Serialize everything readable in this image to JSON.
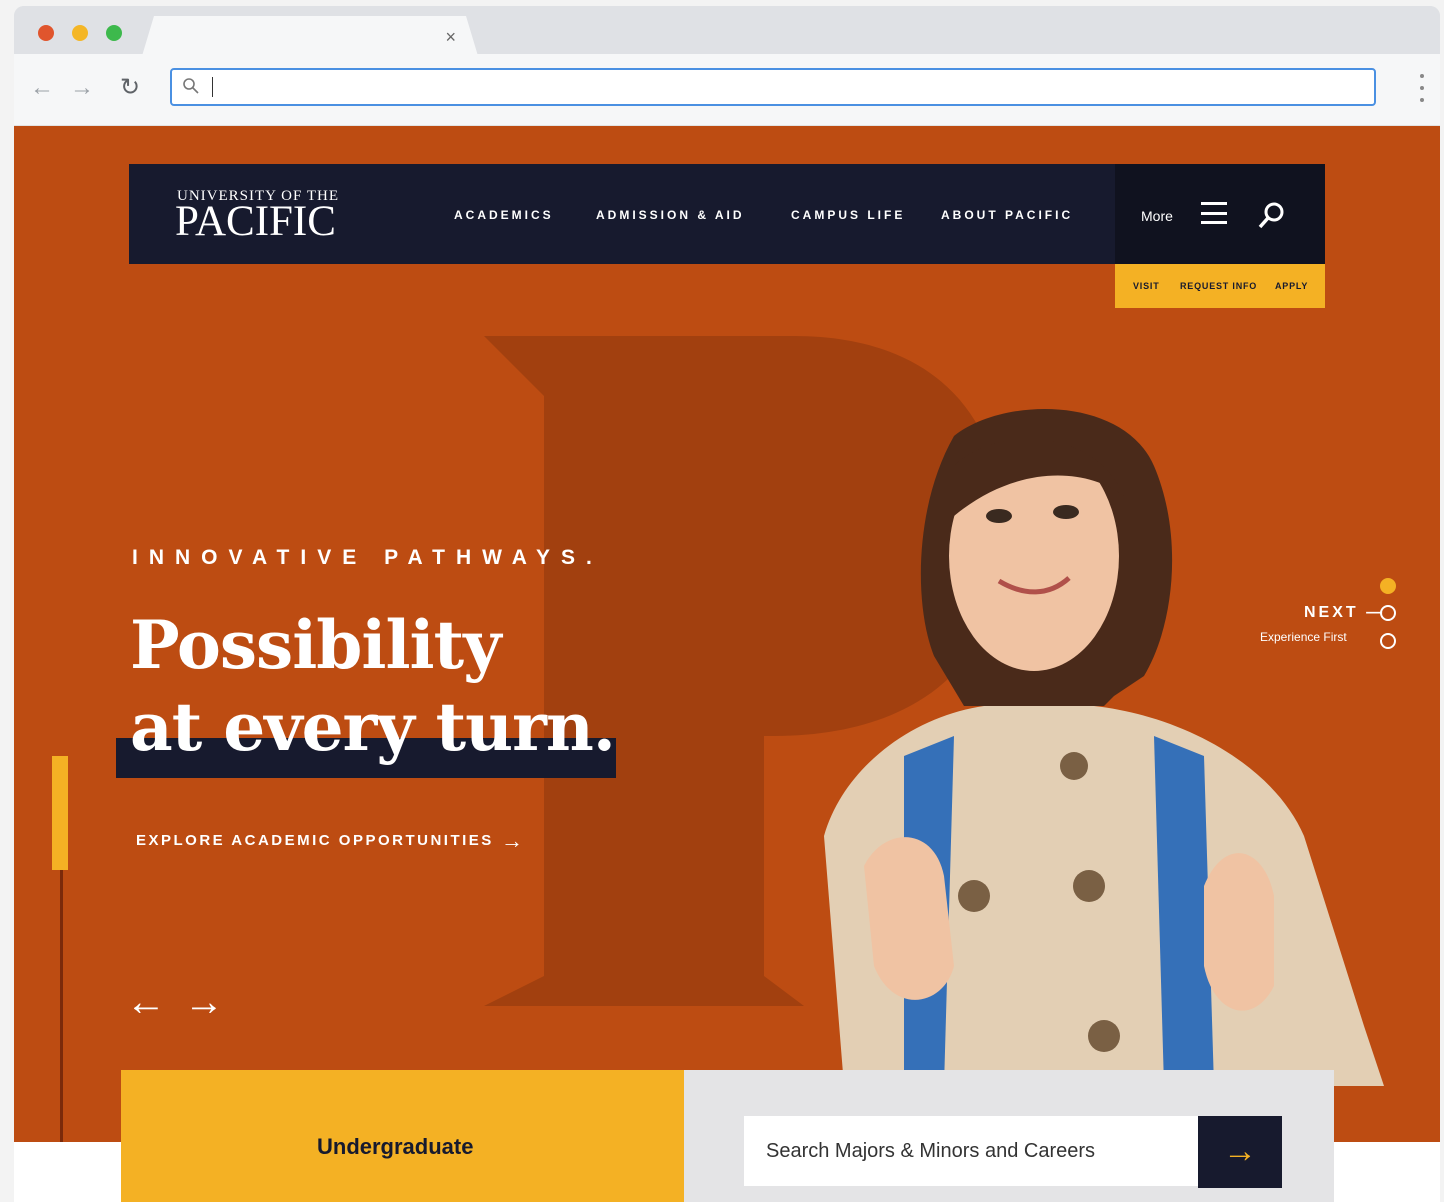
{
  "browser": {
    "tab_close": "×",
    "back": "←",
    "forward": "→",
    "reload": "↻",
    "url_value": ""
  },
  "site": {
    "logo_small": "UNIVERSITY OF THE",
    "logo_big": "PACIFIC",
    "menu": [
      "ACADEMICS",
      "ADMISSION & AID",
      "CAMPUS LIFE",
      "ABOUT PACIFIC"
    ],
    "more_label": "More",
    "cta": [
      "VISIT",
      "REQUEST INFO",
      "APPLY"
    ]
  },
  "hero": {
    "eyebrow": "INNOVATIVE PATHWAYS.",
    "headline_line1": "Possibility",
    "headline_line2": "at every turn.",
    "explore_label": "EXPLORE ACADEMIC OPPORTUNITIES",
    "explore_arrow": "→",
    "prev_arrow": "←",
    "next_arrow": "→",
    "next_label": "NEXT —",
    "next_sub": "Experience First"
  },
  "finder": {
    "tab_label": "Undergraduate",
    "search_placeholder": "Search Majors & Minors and Careers",
    "search_button": "→"
  },
  "colors": {
    "brand_orange": "#bd4c12",
    "navy": "#171a2e",
    "gold": "#f4b124"
  }
}
